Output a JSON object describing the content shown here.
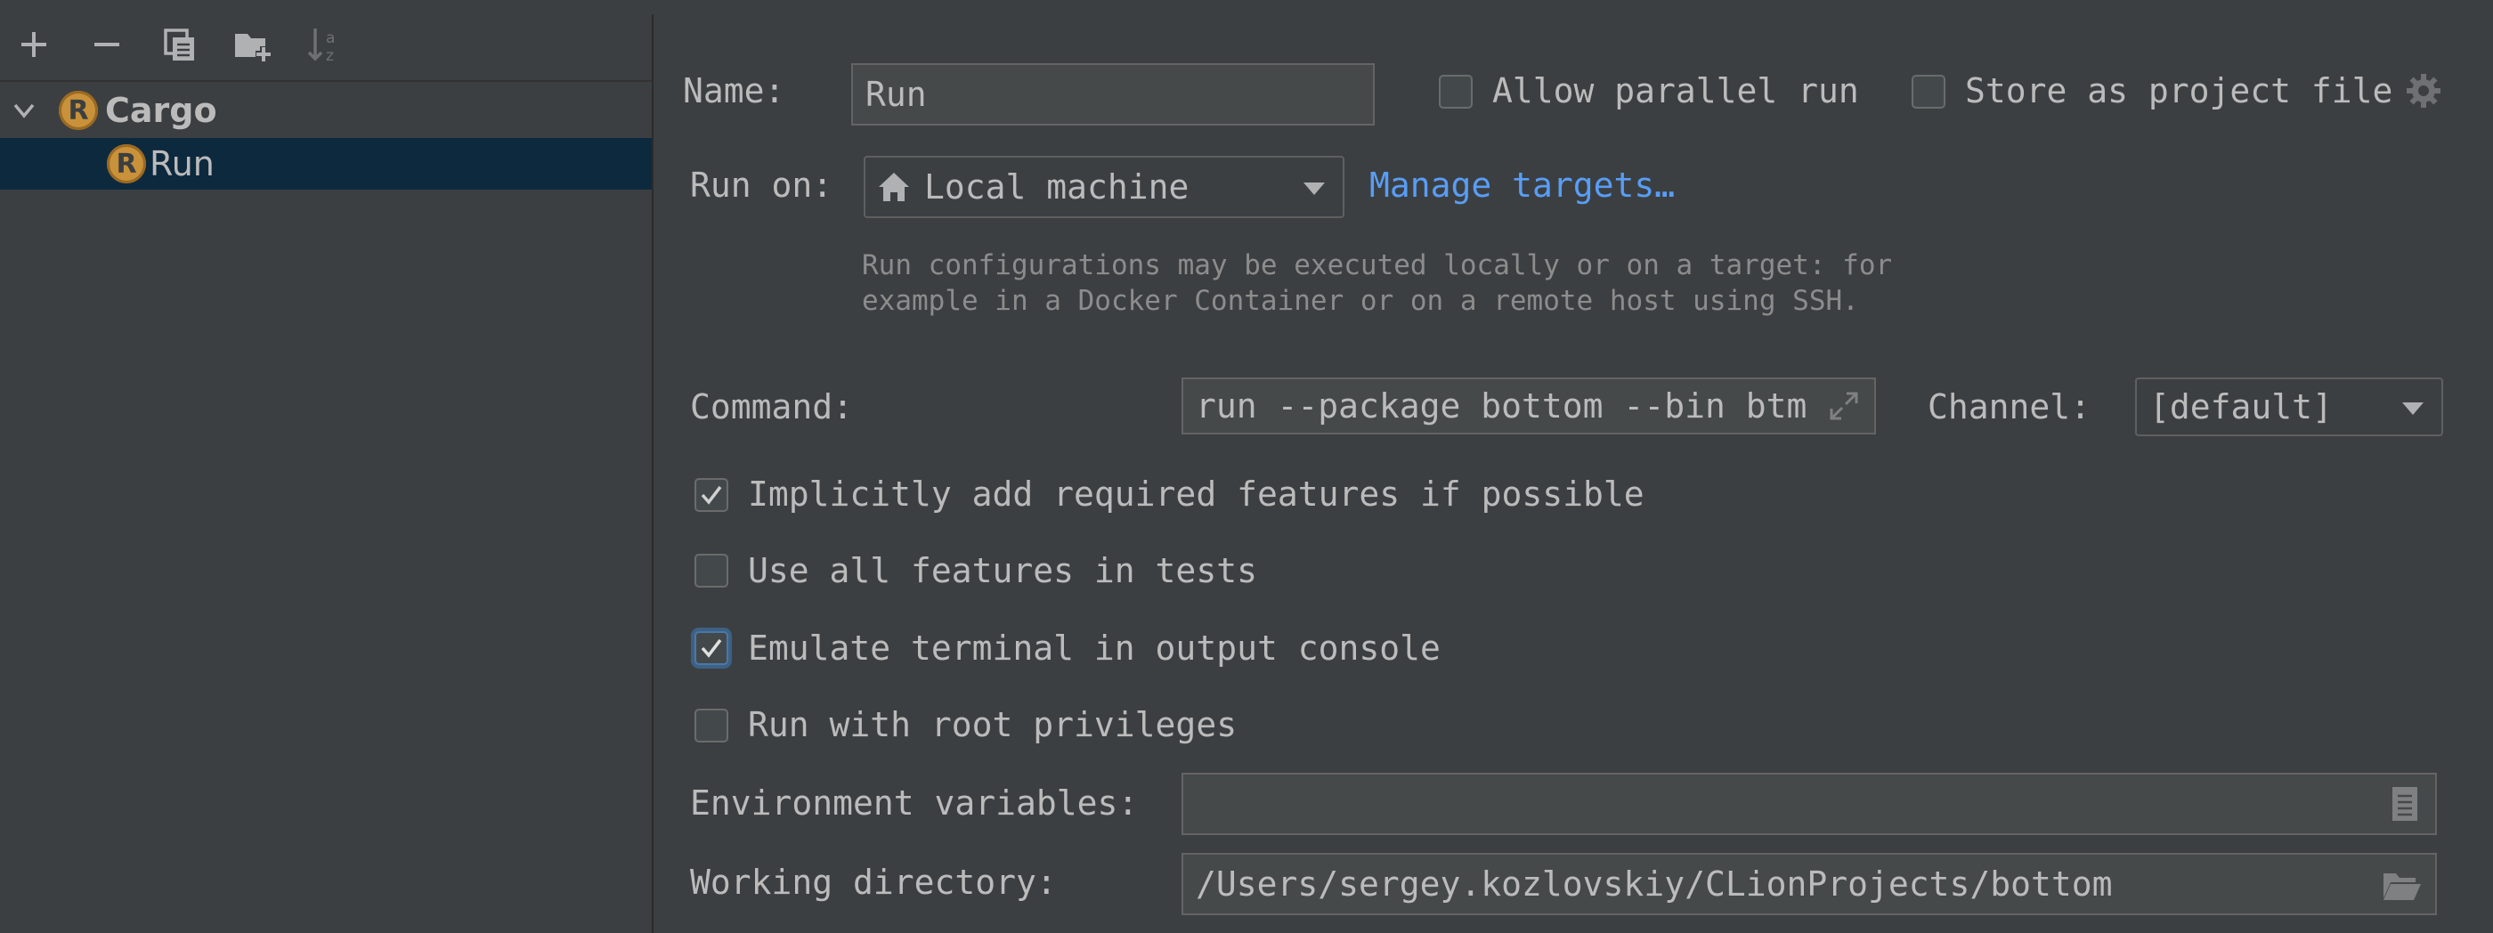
{
  "toolbar": {
    "add_icon": "plus-icon",
    "remove_icon": "minus-icon",
    "copy_icon": "copy-icon",
    "folder_icon": "new-folder-icon",
    "sort_icon": "sort-alphabetically-icon"
  },
  "tree": {
    "group_label": "Cargo",
    "item_label": "Run"
  },
  "form": {
    "name_label": "Name:",
    "name_value": "Run",
    "allow_parallel_label": "Allow parallel run",
    "allow_parallel_checked": false,
    "store_project_label": "Store as project file",
    "store_project_checked": false,
    "run_on_label": "Run on:",
    "run_on_value": "Local machine",
    "manage_targets_label": "Manage targets…",
    "hint_line1": "Run configurations may be executed locally or on a target: for",
    "hint_line2": "example in a Docker Container or on a remote host using SSH.",
    "command_label": "Command:",
    "command_value": "run --package bottom --bin btm",
    "channel_label": "Channel:",
    "channel_value": "[default]",
    "options": [
      {
        "label": "Implicitly add required features if possible",
        "checked": true
      },
      {
        "label": "Use all features in tests",
        "checked": false
      },
      {
        "label": "Emulate terminal in output console",
        "checked": true
      },
      {
        "label": "Run with root privileges",
        "checked": false
      }
    ],
    "env_label": "Environment variables:",
    "env_value": "",
    "workdir_label": "Working directory:",
    "workdir_value": "/Users/sergey.kozlovskiy/CLionProjects/bottom"
  },
  "colors": {
    "background": "#3c3f41",
    "selection": "#0d293e",
    "link": "#589df6",
    "text": "#bbbbbb"
  }
}
